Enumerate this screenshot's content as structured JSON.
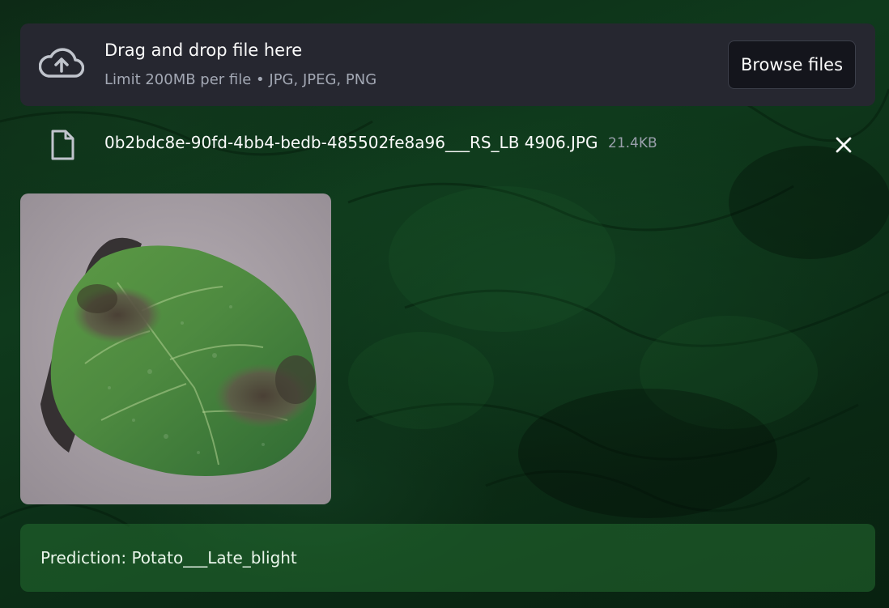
{
  "uploader": {
    "title": "Drag and drop file here",
    "subtitle": "Limit 200MB per file • JPG, JPEG, PNG",
    "browse_label": "Browse files",
    "icon": "cloud-upload-icon"
  },
  "uploaded_file": {
    "name": "0b2bdc8e-90fd-4bb4-bedb-485502fe8a96___RS_LB 4906.JPG",
    "size": "21.4KB",
    "icon": "file-icon",
    "remove_icon": "close-icon"
  },
  "image": {
    "subject": "potato leaf with late blight lesions"
  },
  "prediction": {
    "text": "Prediction: Potato___Late_blight"
  },
  "colors": {
    "panel": "#262730",
    "button_bg": "#14151c",
    "prediction_bg": "#246e32",
    "background": "#0f3a1c"
  }
}
